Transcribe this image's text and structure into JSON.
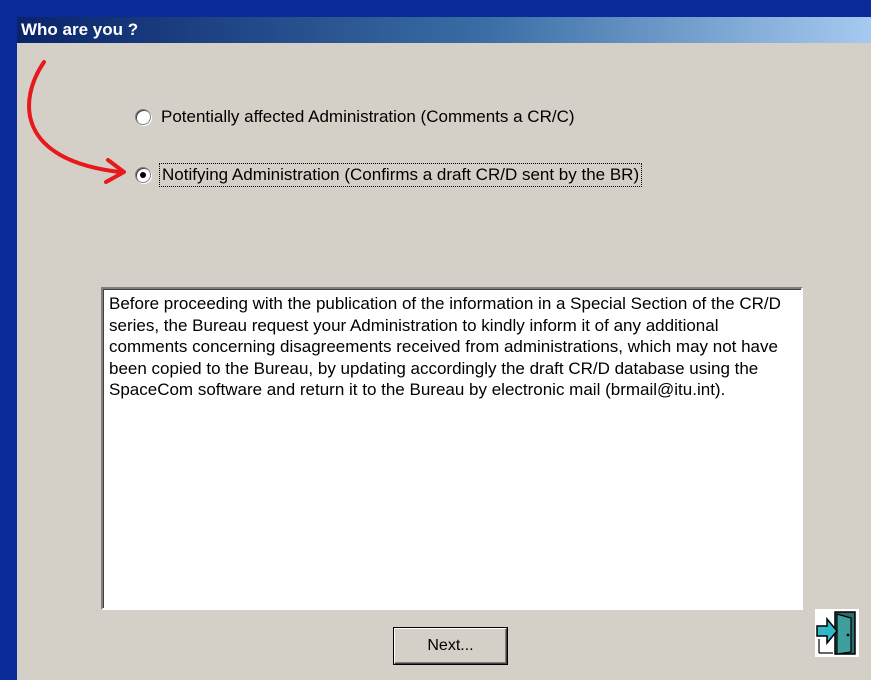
{
  "window": {
    "title": "Who are you ?"
  },
  "options": [
    {
      "label": "Potentially affected Administration (Comments a CR/C)",
      "selected": false
    },
    {
      "label": "Notifying Administration (Confirms a draft CR/D sent by the BR)",
      "selected": true
    }
  ],
  "info_text": "Before proceeding with the publication of the information in a Special Section of the CR/D series, the Bureau request your Administration to kindly inform it of any additional comments concerning disagreements received from administrations, which may not have been copied to the Bureau, by updating accordingly the draft CR/D database using the SpaceCom software and return it to the Bureau by electronic mail (brmail@itu.int).",
  "buttons": {
    "next_label": "Next...",
    "exit_icon": "exit-door-icon"
  },
  "colors": {
    "background": "#0b2a9a",
    "dialog": "#d4d0c8",
    "annotation_arrow": "#e8191c"
  }
}
